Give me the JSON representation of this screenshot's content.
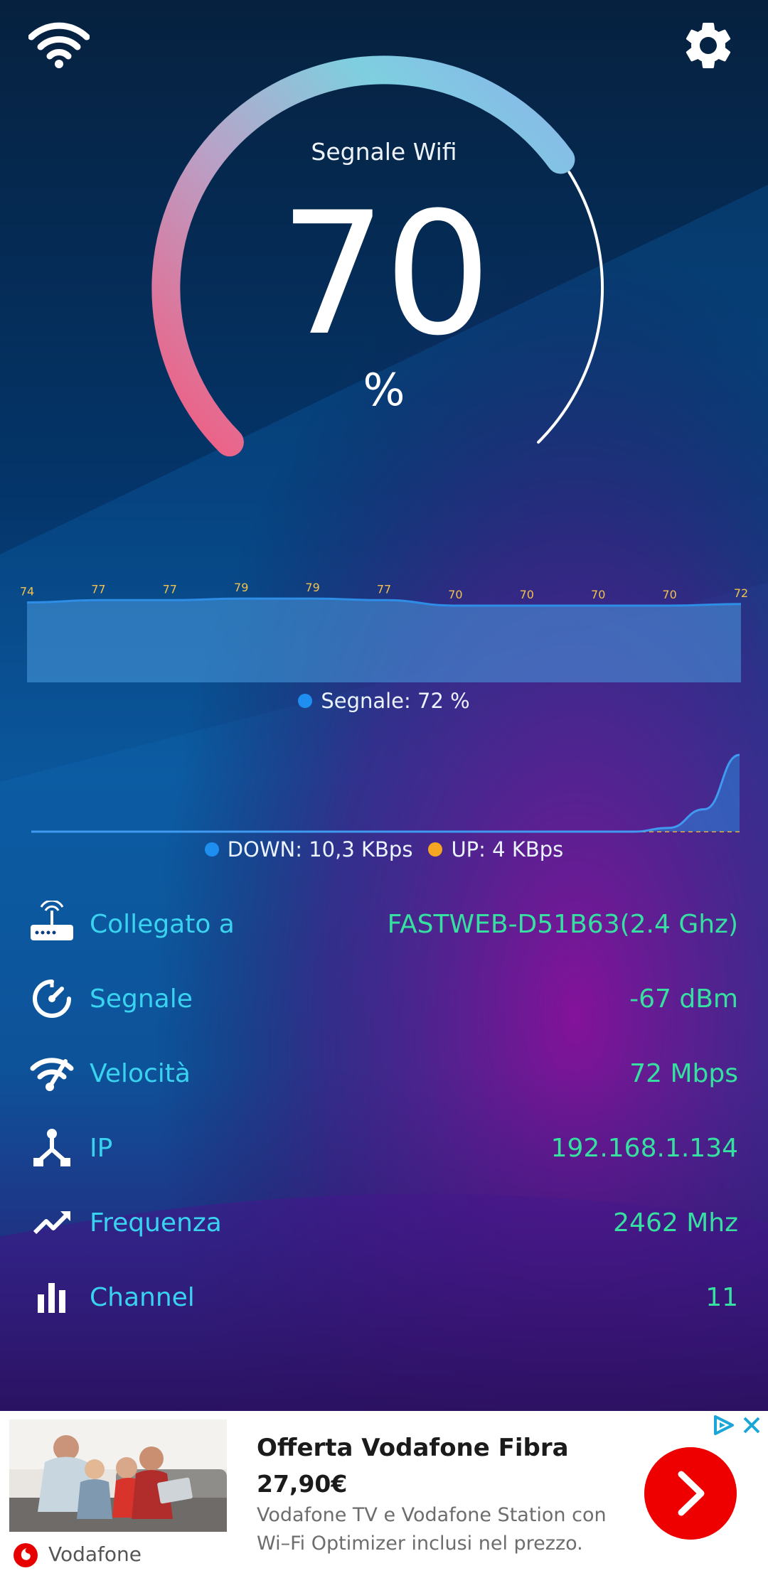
{
  "gauge": {
    "title": "Segnale Wifi",
    "value": "70",
    "unit": "%",
    "level": 0.7
  },
  "signal_chart_legend": "Segnale: 72 %",
  "traffic_legend": {
    "down": "DOWN: 10,3 KBps",
    "up": "UP: 4 KBps"
  },
  "chart_data": [
    {
      "type": "area",
      "values": [
        74,
        77,
        77,
        79,
        79,
        77,
        70,
        70,
        70,
        70,
        72
      ],
      "labels": [
        "74",
        "77",
        "77",
        "79",
        "79",
        "77",
        "70",
        "70",
        "70",
        "70",
        "72"
      ],
      "series": [
        {
          "name": "Segnale",
          "values": [
            74,
            77,
            77,
            79,
            79,
            77,
            70,
            70,
            70,
            70,
            72
          ]
        }
      ]
    },
    {
      "type": "area",
      "series": [
        {
          "name": "DOWN",
          "values": [
            0,
            0,
            0,
            0,
            0,
            0,
            0,
            0,
            0,
            0,
            0,
            0,
            0,
            0,
            0,
            0,
            0,
            0,
            0.5,
            3,
            10.3
          ]
        },
        {
          "name": "UP",
          "values": [
            0,
            0,
            0,
            0,
            0,
            0,
            0,
            0,
            0,
            0,
            0,
            0,
            0,
            0,
            0,
            0,
            0,
            0,
            0,
            0,
            0
          ]
        }
      ]
    }
  ],
  "info": [
    {
      "label": "Collegato a",
      "value": "FASTWEB-D51B63(2.4 Ghz)",
      "icon": "router-icon"
    },
    {
      "label": "Segnale",
      "value": "-67 dBm",
      "icon": "speedometer-icon"
    },
    {
      "label": "Velocità",
      "value": "72 Mbps",
      "icon": "wifi-speed-icon"
    },
    {
      "label": "IP",
      "value": "192.168.1.134",
      "icon": "network-icon"
    },
    {
      "label": "Frequenza",
      "value": "2462 Mhz",
      "icon": "trend-icon"
    },
    {
      "label": "Channel",
      "value": "11",
      "icon": "bar-chart-icon"
    }
  ],
  "ad": {
    "title": "Offerta Vodafone Fibra",
    "price": "27,90€",
    "desc_line1": "Vodafone TV e Vodafone Station con",
    "desc_line2": "Wi–Fi Optimizer inclusi nel prezzo.",
    "brand": "Vodafone"
  },
  "colors": {
    "label": "#39d3f0",
    "value": "#36e0a0",
    "gauge_start": "#f25a7e",
    "gauge_end": "#7fc8e8",
    "ad_cta": "#ee0000"
  }
}
